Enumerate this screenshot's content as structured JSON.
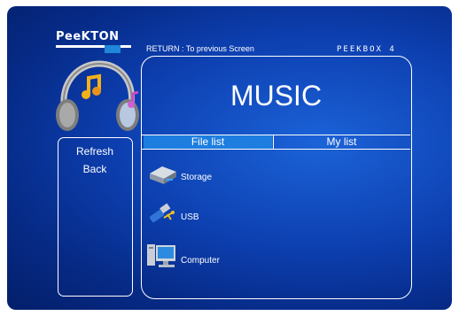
{
  "header": {
    "brand": "PeeKTON",
    "return_hint": "RETURN : To previous Screen",
    "model": "PEEKBOX 4"
  },
  "left_menu": {
    "items": [
      {
        "label": "Refresh"
      },
      {
        "label": "Back"
      }
    ]
  },
  "main": {
    "title": "MUSIC",
    "tabs": [
      {
        "label": "File list",
        "active": true
      },
      {
        "label": "My list",
        "active": false
      }
    ],
    "devices": [
      {
        "label": "Storage",
        "icon": "hard-drive-icon"
      },
      {
        "label": "USB",
        "icon": "usb-icon"
      },
      {
        "label": "Computer",
        "icon": "computer-icon"
      }
    ]
  },
  "colors": {
    "background_deep": "#041f6a",
    "background_light": "#1b63d8",
    "tab_active": "#1d7ee0",
    "text": "#ffffff"
  }
}
